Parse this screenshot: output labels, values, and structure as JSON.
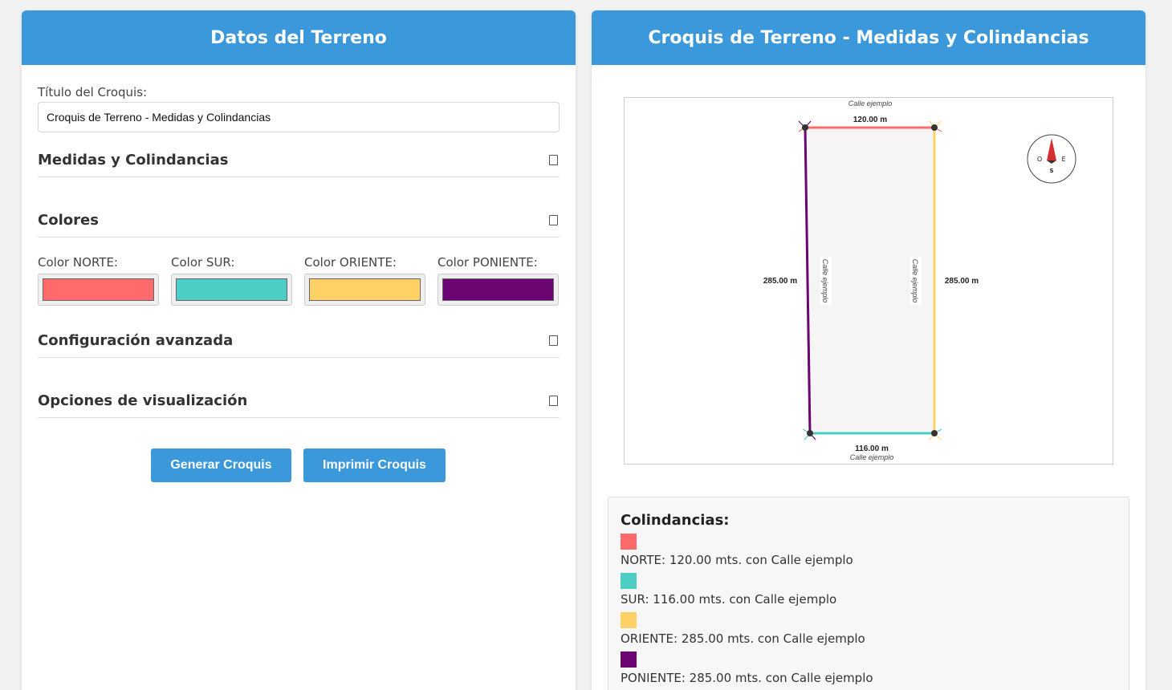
{
  "left": {
    "header": "Datos del Terreno",
    "title_label": "Título del Croquis:",
    "title_value": "Croquis de Terreno - Medidas y Colindancias",
    "sections": {
      "medidas": "Medidas y Colindancias",
      "colores": "Colores",
      "avanzada": "Configuración avanzada",
      "visualizacion": "Opciones de visualización"
    },
    "colors": [
      {
        "label": "Color NORTE:",
        "value": "#ff6b6b"
      },
      {
        "label": "Color SUR:",
        "value": "#4ecdc4"
      },
      {
        "label": "Color ORIENTE:",
        "value": "#ffd166"
      },
      {
        "label": "Color PONIENTE:",
        "value": "#6a0572"
      }
    ],
    "buttons": {
      "generate": "Generar Croquis",
      "print": "Imprimir Croquis"
    }
  },
  "right": {
    "header": "Croquis de Terreno - Medidas y Colindancias",
    "sketch": {
      "north_street": "Calle ejemplo",
      "south_street": "Calle ejemplo",
      "west_street": "Calle ejemplo",
      "east_street": "Calle ejemplo",
      "north_measure": "120.00 m",
      "south_measure": "116.00 m",
      "west_measure": "285.00 m",
      "east_measure": "285.00 m",
      "compass": {
        "west": "O",
        "east": "E",
        "south": "S"
      }
    },
    "legend": {
      "title": "Colindancias:",
      "items": [
        {
          "color": "#ff6b6b",
          "text": "NORTE: 120.00 mts. con Calle ejemplo"
        },
        {
          "color": "#4ecdc4",
          "text": "SUR: 116.00 mts. con Calle ejemplo"
        },
        {
          "color": "#ffd166",
          "text": "ORIENTE: 285.00 mts. con Calle ejemplo"
        },
        {
          "color": "#6a0572",
          "text": "PONIENTE: 285.00 mts. con Calle ejemplo"
        }
      ]
    }
  }
}
